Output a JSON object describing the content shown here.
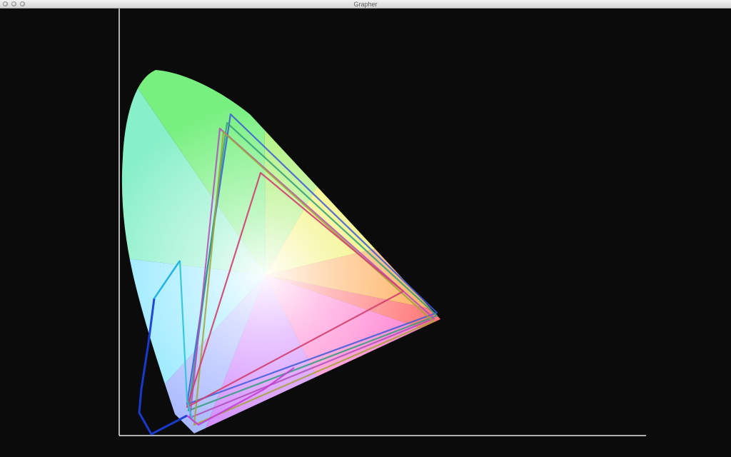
{
  "window": {
    "title": "Grapher"
  },
  "colors": {
    "background": "#0b0b0b",
    "axis": "#e0e0e0"
  },
  "plot": {
    "description_type": "chromaticity diagram with gamut triangles"
  }
}
